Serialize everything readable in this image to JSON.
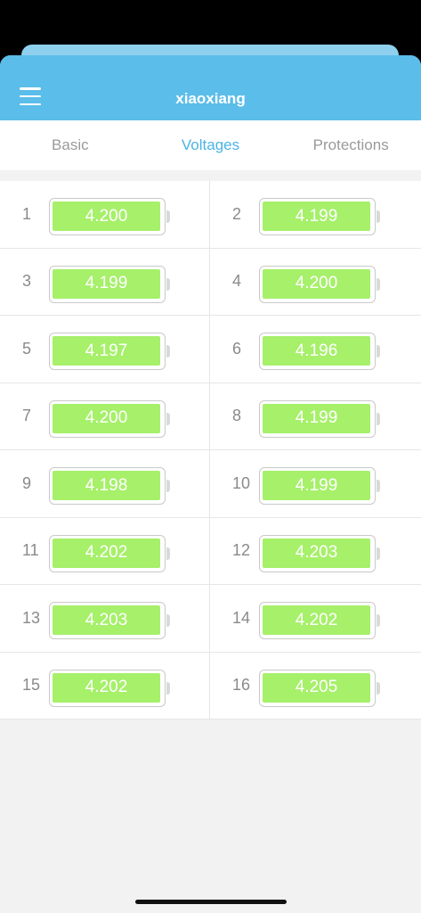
{
  "app": {
    "title": "xiaoxiang"
  },
  "tabs": [
    {
      "label": "Basic",
      "active": false
    },
    {
      "label": "Voltages",
      "active": true
    },
    {
      "label": "Protections",
      "active": false
    }
  ],
  "colors": {
    "header": "#5bbde9",
    "active_tab": "#4bb4e6",
    "battery_fill": "#a6f06a"
  },
  "cells": [
    {
      "index": "1",
      "voltage": "4.200"
    },
    {
      "index": "2",
      "voltage": "4.199"
    },
    {
      "index": "3",
      "voltage": "4.199"
    },
    {
      "index": "4",
      "voltage": "4.200"
    },
    {
      "index": "5",
      "voltage": "4.197"
    },
    {
      "index": "6",
      "voltage": "4.196"
    },
    {
      "index": "7",
      "voltage": "4.200"
    },
    {
      "index": "8",
      "voltage": "4.199"
    },
    {
      "index": "9",
      "voltage": "4.198"
    },
    {
      "index": "10",
      "voltage": "4.199"
    },
    {
      "index": "11",
      "voltage": "4.202"
    },
    {
      "index": "12",
      "voltage": "4.203"
    },
    {
      "index": "13",
      "voltage": "4.203"
    },
    {
      "index": "14",
      "voltage": "4.202"
    },
    {
      "index": "15",
      "voltage": "4.202"
    },
    {
      "index": "16",
      "voltage": "4.205"
    }
  ]
}
